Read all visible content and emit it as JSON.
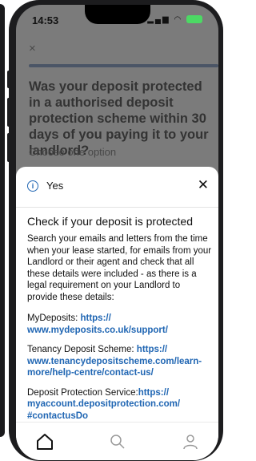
{
  "status_bar": {
    "time": "14:53",
    "signal": "..ll",
    "wifi": "wifi"
  },
  "background": {
    "close_label": "×",
    "question": "Was your deposit protected in a authorised deposit protection scheme within 30 days of you paying it to your landlord?",
    "hint": "Choose one option"
  },
  "sheet": {
    "title": "Yes",
    "close_label": "✕",
    "heading": "Check if your deposit is protected",
    "paragraph": "Search your emails and letters from the time when your lease started, for emails from your Landlord or their agent and check that all these details were included - as there is a legal requirement on your Landlord to provide these details:",
    "links": [
      {
        "label": "MyDeposits: ",
        "url": "https:// www.mydeposits.co.uk/support/"
      },
      {
        "label": "Tenancy Deposit Scheme: ",
        "url": "https:// www.tenancydepositscheme.com/learn-more/help-centre/contact-us/"
      },
      {
        "label": "Deposit Protection Service:",
        "url": "https:// myaccount.depositprotection.com/ #contactusDo"
      }
    ]
  },
  "bottom_nav": {
    "items": [
      "home",
      "search",
      "profile"
    ]
  },
  "colors": {
    "accent": "#2066b3",
    "overlay": "#7b7b7b",
    "progress": "#4b5566"
  }
}
